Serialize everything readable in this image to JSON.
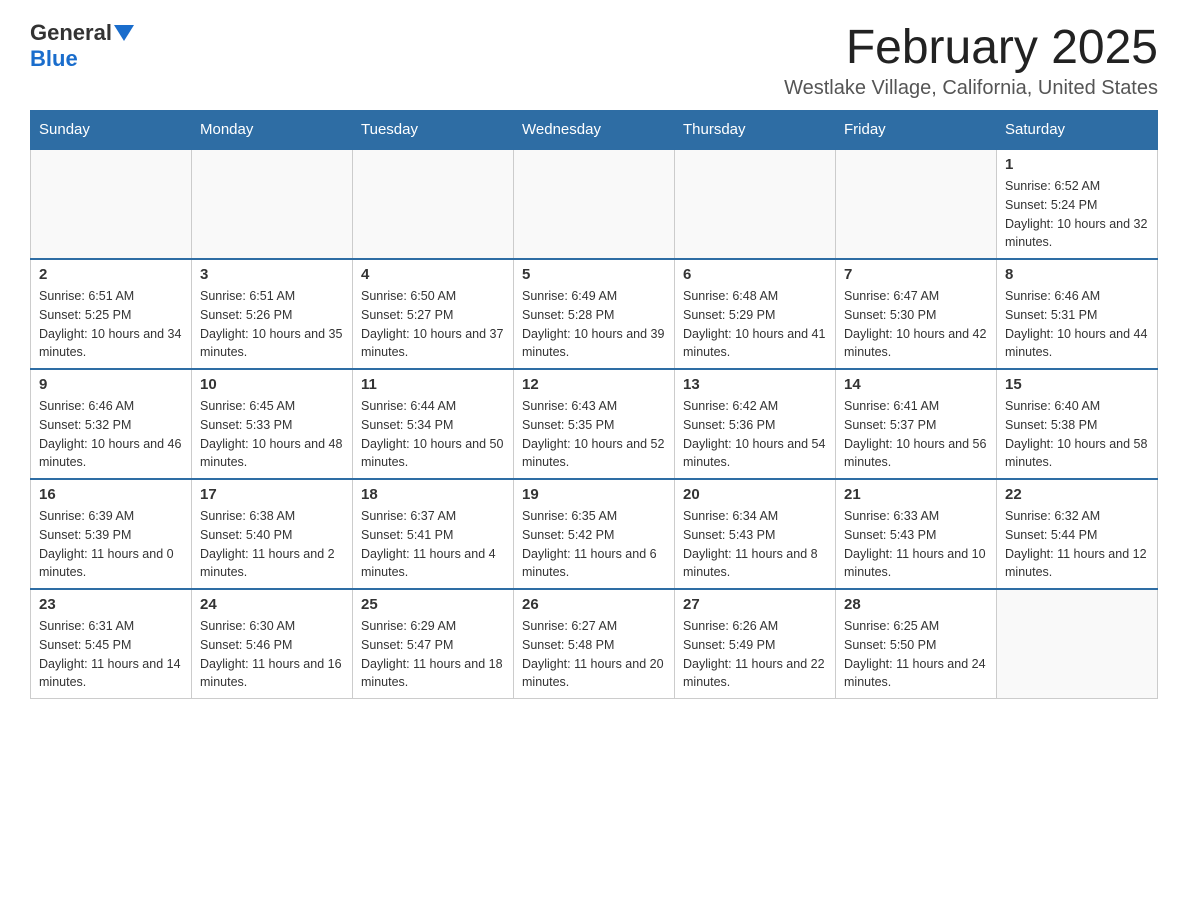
{
  "header": {
    "logo": {
      "general": "General",
      "blue": "Blue"
    },
    "title": "February 2025",
    "subtitle": "Westlake Village, California, United States"
  },
  "days_of_week": [
    "Sunday",
    "Monday",
    "Tuesday",
    "Wednesday",
    "Thursday",
    "Friday",
    "Saturday"
  ],
  "weeks": [
    [
      {
        "day": "",
        "info": ""
      },
      {
        "day": "",
        "info": ""
      },
      {
        "day": "",
        "info": ""
      },
      {
        "day": "",
        "info": ""
      },
      {
        "day": "",
        "info": ""
      },
      {
        "day": "",
        "info": ""
      },
      {
        "day": "1",
        "info": "Sunrise: 6:52 AM\nSunset: 5:24 PM\nDaylight: 10 hours and 32 minutes."
      }
    ],
    [
      {
        "day": "2",
        "info": "Sunrise: 6:51 AM\nSunset: 5:25 PM\nDaylight: 10 hours and 34 minutes."
      },
      {
        "day": "3",
        "info": "Sunrise: 6:51 AM\nSunset: 5:26 PM\nDaylight: 10 hours and 35 minutes."
      },
      {
        "day": "4",
        "info": "Sunrise: 6:50 AM\nSunset: 5:27 PM\nDaylight: 10 hours and 37 minutes."
      },
      {
        "day": "5",
        "info": "Sunrise: 6:49 AM\nSunset: 5:28 PM\nDaylight: 10 hours and 39 minutes."
      },
      {
        "day": "6",
        "info": "Sunrise: 6:48 AM\nSunset: 5:29 PM\nDaylight: 10 hours and 41 minutes."
      },
      {
        "day": "7",
        "info": "Sunrise: 6:47 AM\nSunset: 5:30 PM\nDaylight: 10 hours and 42 minutes."
      },
      {
        "day": "8",
        "info": "Sunrise: 6:46 AM\nSunset: 5:31 PM\nDaylight: 10 hours and 44 minutes."
      }
    ],
    [
      {
        "day": "9",
        "info": "Sunrise: 6:46 AM\nSunset: 5:32 PM\nDaylight: 10 hours and 46 minutes."
      },
      {
        "day": "10",
        "info": "Sunrise: 6:45 AM\nSunset: 5:33 PM\nDaylight: 10 hours and 48 minutes."
      },
      {
        "day": "11",
        "info": "Sunrise: 6:44 AM\nSunset: 5:34 PM\nDaylight: 10 hours and 50 minutes."
      },
      {
        "day": "12",
        "info": "Sunrise: 6:43 AM\nSunset: 5:35 PM\nDaylight: 10 hours and 52 minutes."
      },
      {
        "day": "13",
        "info": "Sunrise: 6:42 AM\nSunset: 5:36 PM\nDaylight: 10 hours and 54 minutes."
      },
      {
        "day": "14",
        "info": "Sunrise: 6:41 AM\nSunset: 5:37 PM\nDaylight: 10 hours and 56 minutes."
      },
      {
        "day": "15",
        "info": "Sunrise: 6:40 AM\nSunset: 5:38 PM\nDaylight: 10 hours and 58 minutes."
      }
    ],
    [
      {
        "day": "16",
        "info": "Sunrise: 6:39 AM\nSunset: 5:39 PM\nDaylight: 11 hours and 0 minutes."
      },
      {
        "day": "17",
        "info": "Sunrise: 6:38 AM\nSunset: 5:40 PM\nDaylight: 11 hours and 2 minutes."
      },
      {
        "day": "18",
        "info": "Sunrise: 6:37 AM\nSunset: 5:41 PM\nDaylight: 11 hours and 4 minutes."
      },
      {
        "day": "19",
        "info": "Sunrise: 6:35 AM\nSunset: 5:42 PM\nDaylight: 11 hours and 6 minutes."
      },
      {
        "day": "20",
        "info": "Sunrise: 6:34 AM\nSunset: 5:43 PM\nDaylight: 11 hours and 8 minutes."
      },
      {
        "day": "21",
        "info": "Sunrise: 6:33 AM\nSunset: 5:43 PM\nDaylight: 11 hours and 10 minutes."
      },
      {
        "day": "22",
        "info": "Sunrise: 6:32 AM\nSunset: 5:44 PM\nDaylight: 11 hours and 12 minutes."
      }
    ],
    [
      {
        "day": "23",
        "info": "Sunrise: 6:31 AM\nSunset: 5:45 PM\nDaylight: 11 hours and 14 minutes."
      },
      {
        "day": "24",
        "info": "Sunrise: 6:30 AM\nSunset: 5:46 PM\nDaylight: 11 hours and 16 minutes."
      },
      {
        "day": "25",
        "info": "Sunrise: 6:29 AM\nSunset: 5:47 PM\nDaylight: 11 hours and 18 minutes."
      },
      {
        "day": "26",
        "info": "Sunrise: 6:27 AM\nSunset: 5:48 PM\nDaylight: 11 hours and 20 minutes."
      },
      {
        "day": "27",
        "info": "Sunrise: 6:26 AM\nSunset: 5:49 PM\nDaylight: 11 hours and 22 minutes."
      },
      {
        "day": "28",
        "info": "Sunrise: 6:25 AM\nSunset: 5:50 PM\nDaylight: 11 hours and 24 minutes."
      },
      {
        "day": "",
        "info": ""
      }
    ]
  ]
}
